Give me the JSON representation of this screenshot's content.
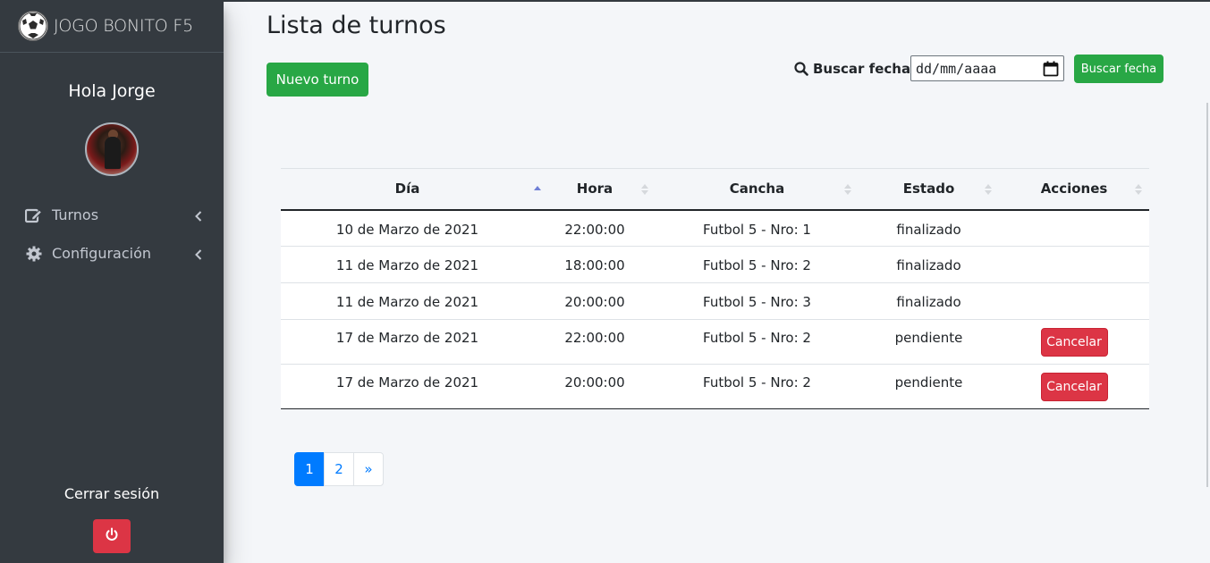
{
  "brand": {
    "name": "JOGO BONITO F5",
    "logo_icon": "soccer-ball-icon"
  },
  "sidebar": {
    "greeting": "Hola Jorge",
    "items": [
      {
        "label": "Turnos",
        "icon": "edit-icon"
      },
      {
        "label": "Configuración",
        "icon": "gear-icon"
      }
    ],
    "logout_label": "Cerrar sesión"
  },
  "main": {
    "title": "Lista de turnos",
    "new_button": "Nuevo turno",
    "search_label": "Buscar fecha",
    "date_placeholder": "dd/mm/aaaa",
    "search_button": "Buscar fecha"
  },
  "table": {
    "columns": [
      "Día",
      "Hora",
      "Cancha",
      "Estado",
      "Acciones"
    ],
    "sorted_column": "Día",
    "rows": [
      {
        "dia": "10 de Marzo de 2021",
        "hora": "22:00:00",
        "cancha": "Futbol 5 - Nro: 1",
        "estado": "finalizado",
        "accion": ""
      },
      {
        "dia": "11 de Marzo de 2021",
        "hora": "18:00:00",
        "cancha": "Futbol 5 - Nro: 2",
        "estado": "finalizado",
        "accion": ""
      },
      {
        "dia": "11 de Marzo de 2021",
        "hora": "20:00:00",
        "cancha": "Futbol 5 - Nro: 3",
        "estado": "finalizado",
        "accion": ""
      },
      {
        "dia": "17 de Marzo de 2021",
        "hora": "22:00:00",
        "cancha": "Futbol 5 - Nro: 2",
        "estado": "pendiente",
        "accion": "Cancelar"
      },
      {
        "dia": "17 de Marzo de 2021",
        "hora": "20:00:00",
        "cancha": "Futbol 5 - Nro: 2",
        "estado": "pendiente",
        "accion": "Cancelar"
      }
    ]
  },
  "pagination": {
    "pages": [
      "1",
      "2"
    ],
    "next": "»",
    "current": "1"
  },
  "colors": {
    "sidebar": "#343a40",
    "success": "#28a745",
    "danger": "#dc3545",
    "primary": "#007bff"
  }
}
